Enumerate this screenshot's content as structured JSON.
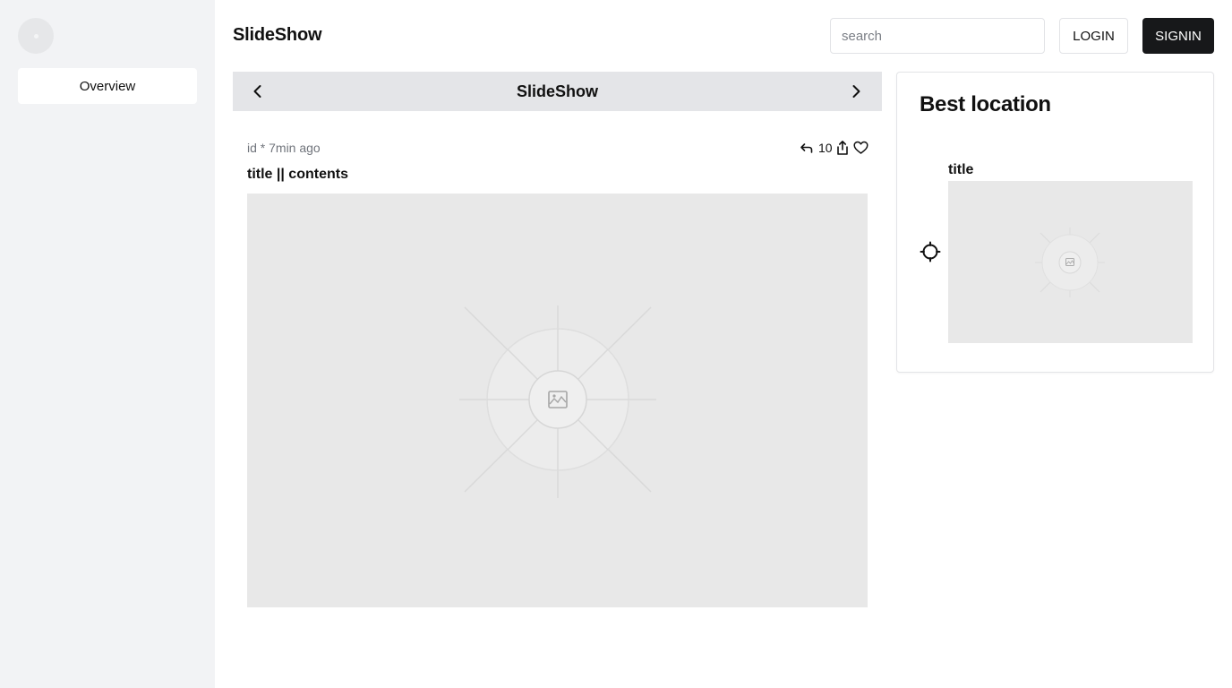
{
  "sidebar": {
    "avatar_icon": "avatar-placeholder",
    "items": [
      {
        "label": "Overview"
      }
    ]
  },
  "header": {
    "title": "SlideShow",
    "search": {
      "placeholder": "search",
      "value": ""
    },
    "login_label": "LOGIN",
    "signin_label": "SIGNIN"
  },
  "slideshow": {
    "title": "SlideShow",
    "prev_icon": "chevron-left-icon",
    "next_icon": "chevron-right-icon",
    "post": {
      "meta": "id * 7min ago",
      "title": "title || contents",
      "reply_icon": "reply-icon",
      "count": "10",
      "share_icon": "share-icon",
      "like_icon": "heart-icon",
      "image_icon": "image-placeholder-icon"
    }
  },
  "best_location": {
    "heading": "Best location",
    "locate_icon": "crosshair-icon",
    "item": {
      "title": "title",
      "image_icon": "image-placeholder-icon"
    }
  },
  "colors": {
    "sidebar_bg": "#f2f3f5",
    "slide_bar_bg": "#e4e5e8",
    "signin_bg": "#17181a",
    "placeholder_bg": "#e8e8e8",
    "meta_text": "#71757c"
  }
}
